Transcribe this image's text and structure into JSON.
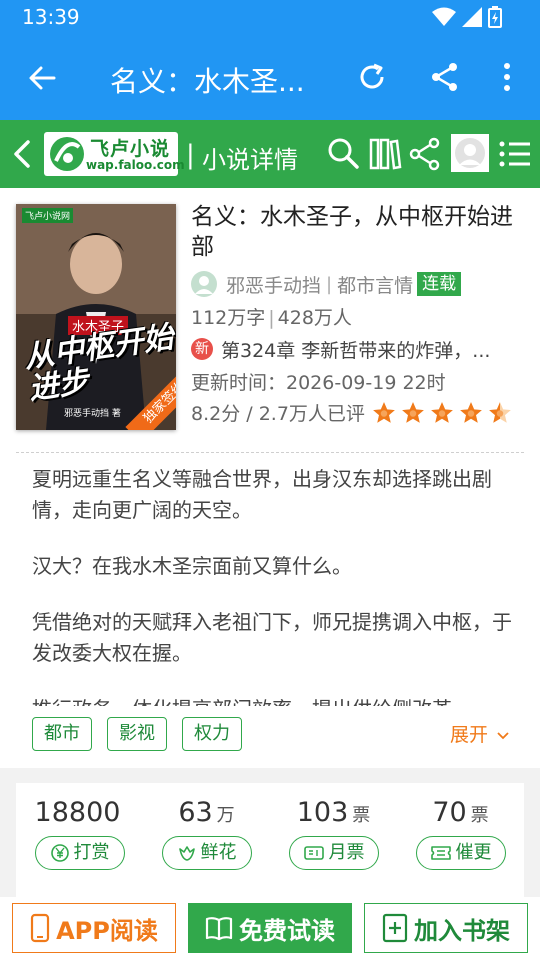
{
  "status_bar": {
    "time": "13:39"
  },
  "app_bar": {
    "title": "名义：水木圣..."
  },
  "site_header": {
    "logo_name": "飞卢小说",
    "logo_url": "wap.faloo.com",
    "separator": "|",
    "page_title": "小说详情"
  },
  "book": {
    "title": "名义：水木圣子，从中枢开始进部",
    "cover": {
      "site": "飞卢小说网",
      "small_title": "水木圣子",
      "big_title": "从中枢开始进步",
      "author": "邪恶手动挡 著",
      "ribbon": "独家签约"
    },
    "author": "邪恶手动挡",
    "category": "都市言情",
    "status": "连载",
    "words": "112万字",
    "readers": "428万人",
    "new_badge": "新",
    "latest_chapter": "第324章 李新哲带来的炸弹，...",
    "update_label": "更新时间：2026-09-19 22时",
    "rating_text": "8.2分 / 2.7万人已评",
    "rating_stars": 4.5,
    "intro": [
      "夏明远重生名义等融合世界，出身汉东却选择跳出剧情，走向更广阔的天空。",
      "汉大？在我水木圣宗面前又算什么。",
      "凭借绝对的天赋拜入老祖门下，师兄提携调入中枢，于发改委大权在握。",
      "推行政务一体化提高部门效率，提出供给侧改革"
    ],
    "tags": [
      "都市",
      "影视",
      "权力"
    ],
    "expand_label": "展开"
  },
  "stats": [
    {
      "num": "18800",
      "unit": "",
      "label": "打赏",
      "icon": "yen-coin-icon"
    },
    {
      "num": "63",
      "unit": "万",
      "label": "鲜花",
      "icon": "flower-icon"
    },
    {
      "num": "103",
      "unit": "票",
      "label": "月票",
      "icon": "ticket-icon"
    },
    {
      "num": "70",
      "unit": "票",
      "label": "催更",
      "icon": "urge-ticket-icon"
    }
  ],
  "bottom_bar": {
    "app_read": "APP阅读",
    "free_trial": "免费试读",
    "add_shelf": "加入书架"
  },
  "colors": {
    "toolbar_blue": "#2196f3",
    "site_green": "#31a84b",
    "accent_orange": "#f07a1a",
    "new_red": "#e8504a"
  }
}
